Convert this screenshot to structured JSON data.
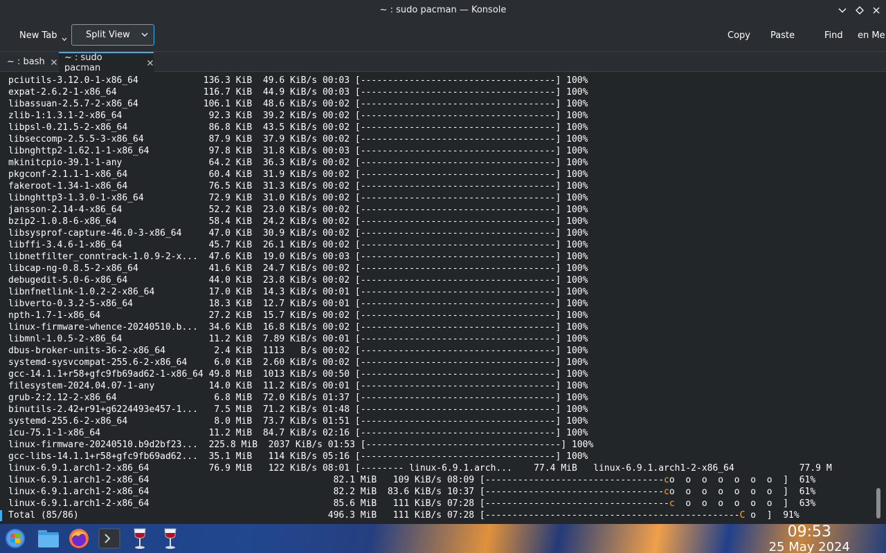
{
  "window": {
    "title": "~ : sudo pacman — Konsole"
  },
  "toolbar": {
    "new_tab": "New Tab",
    "split_view": "Split View",
    "copy": "Copy",
    "paste": "Paste",
    "find": "Find",
    "more": "en Me"
  },
  "tabs": [
    {
      "label": "~ : bash"
    },
    {
      "label": "~ : sudo pacman"
    }
  ],
  "terminal": {
    "lines": [
      "pciutils-3.12.0-1-x86_64            136.3 KiB  49.6 KiB/s 00:03 [------------------------------------] 100%",
      "expat-2.6.2-1-x86_64                116.7 KiB  44.9 KiB/s 00:03 [------------------------------------] 100%",
      "libassuan-2.5.7-2-x86_64            106.1 KiB  48.6 KiB/s 00:02 [------------------------------------] 100%",
      "zlib-1:1.3.1-2-x86_64                92.3 KiB  39.2 KiB/s 00:02 [------------------------------------] 100%",
      "libpsl-0.21.5-2-x86_64               86.8 KiB  43.5 KiB/s 00:02 [------------------------------------] 100%",
      "libseccomp-2.5.5-3-x86_64            87.9 KiB  37.9 KiB/s 00:02 [------------------------------------] 100%",
      "libnghttp2-1.62.1-1-x86_64           97.8 KiB  31.8 KiB/s 00:03 [------------------------------------] 100%",
      "mkinitcpio-39.1-1-any                64.2 KiB  36.3 KiB/s 00:02 [------------------------------------] 100%",
      "pkgconf-2.1.1-1-x86_64               60.4 KiB  31.9 KiB/s 00:02 [------------------------------------] 100%",
      "fakeroot-1.34-1-x86_64               76.5 KiB  31.3 KiB/s 00:02 [------------------------------------] 100%",
      "libnghttp3-1.3.0-1-x86_64            72.9 KiB  31.0 KiB/s 00:02 [------------------------------------] 100%",
      "jansson-2.14-4-x86_64                52.2 KiB  23.0 KiB/s 00:02 [------------------------------------] 100%",
      "bzip2-1.0.8-6-x86_64                 58.4 KiB  24.2 KiB/s 00:02 [------------------------------------] 100%",
      "libsysprof-capture-46.0-3-x86_64     47.0 KiB  30.9 KiB/s 00:02 [------------------------------------] 100%",
      "libffi-3.4.6-1-x86_64                45.7 KiB  26.1 KiB/s 00:02 [------------------------------------] 100%",
      "libnetfilter_conntrack-1.0.9-2-x...  47.6 KiB  19.0 KiB/s 00:03 [------------------------------------] 100%",
      "libcap-ng-0.8.5-2-x86_64             41.6 KiB  24.7 KiB/s 00:02 [------------------------------------] 100%",
      "debugedit-5.0-6-x86_64               44.0 KiB  23.8 KiB/s 00:02 [------------------------------------] 100%",
      "libnfnetlink-1.0.2-2-x86_64          17.0 KiB  14.3 KiB/s 00:01 [------------------------------------] 100%",
      "libverto-0.3.2-5-x86_64              18.3 KiB  12.7 KiB/s 00:01 [------------------------------------] 100%",
      "npth-1.7-1-x86_64                    27.2 KiB  15.7 KiB/s 00:02 [------------------------------------] 100%",
      "linux-firmware-whence-20240510.b...  34.6 KiB  16.8 KiB/s 00:02 [------------------------------------] 100%",
      "libmnl-1.0.5-2-x86_64                11.2 KiB  7.89 KiB/s 00:01 [------------------------------------] 100%",
      "dbus-broker-units-36-2-x86_64         2.4 KiB  1113   B/s 00:02 [------------------------------------] 100%",
      "systemd-sysvcompat-255.6-2-x86_64     6.0 KiB  2.60 KiB/s 00:02 [------------------------------------] 100%",
      "gcc-14.1.1+r58+gfc9fb69ad62-1-x86_64 49.8 MiB  1013 KiB/s 00:50 [------------------------------------] 100%",
      "filesystem-2024.04.07-1-any          14.0 KiB  11.2 KiB/s 00:01 [------------------------------------] 100%",
      "grub-2:2.12-2-x86_64                  6.8 MiB  72.0 KiB/s 01:37 [------------------------------------] 100%",
      "binutils-2.42+r91+g6224493e457-1...   7.5 MiB  71.2 KiB/s 01:48 [------------------------------------] 100%",
      "systemd-255.6-2-x86_64                8.0 MiB  73.7 KiB/s 01:51 [------------------------------------] 100%",
      "icu-75.1-1-x86_64                    11.2 MiB  84.7 KiB/s 02:16 [------------------------------------] 100%",
      "linux-firmware-20240510.b9d2bf23...  225.8 MiB  2037 KiB/s 01:53 [------------------------------------] 100%",
      "gcc-libs-14.1.1+r58+gfc9fb69ad62...  35.1 MiB   114 KiB/s 05:16 [------------------------------------] 100%",
      "linux-6.9.1.arch1-2-x86_64           76.9 MiB   122 KiB/s 08:01 [-------- linux-6.9.1.arch...    77.4 MiB   linux-6.9.1.arch1-2-x86_64            77.9 M"
    ],
    "progress_lines": [
      {
        "text": "linux-6.9.1.arch1-2-x86_64                                  82.1 MiB   109 KiB/s 08:09 [---------------------------------",
        "marker": "c",
        "tail": "o  o  o  o  o  o  o  ]  61%"
      },
      {
        "text": "linux-6.9.1.arch1-2-x86_64                                  82.2 MiB  83.6 KiB/s 10:37 [---------------------------------",
        "marker": "c",
        "tail": "o  o  o  o  o  o  o  ]  61%"
      },
      {
        "text": "linux-6.9.1.arch1-2-x86_64                                  85.6 MiB   111 KiB/s 07:28 [----------------------------------",
        "marker": "c",
        "tail": "  o  o  o  o  o  o  ]  63%"
      },
      {
        "text": "Total (85/86)                                              496.3 MiB   111 KiB/s 07:28 [-----------------------------------------------",
        "marker": "C",
        "tail": " o  ]  91%"
      }
    ]
  },
  "taskbar": {
    "icons": [
      "start-menu-icon",
      "files-icon",
      "firefox-icon",
      "terminal-icon",
      "wine-glass-icon",
      "wine-glass-icon"
    ],
    "time": "09:53",
    "date": "25 May 2024"
  },
  "colors": {
    "accent": "#3daee9",
    "progress_marker": "#f4a934",
    "terminal_bg": "#232629"
  }
}
